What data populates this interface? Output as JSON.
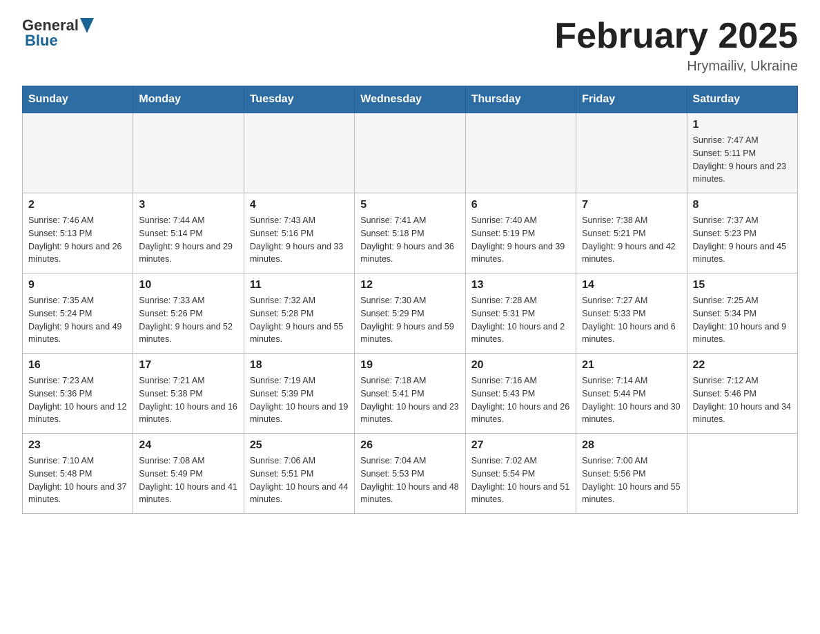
{
  "header": {
    "logo_general": "General",
    "logo_blue": "Blue",
    "month_title": "February 2025",
    "location": "Hrymailiv, Ukraine"
  },
  "days_of_week": [
    "Sunday",
    "Monday",
    "Tuesday",
    "Wednesday",
    "Thursday",
    "Friday",
    "Saturday"
  ],
  "weeks": [
    {
      "days": [
        {
          "number": "",
          "info": ""
        },
        {
          "number": "",
          "info": ""
        },
        {
          "number": "",
          "info": ""
        },
        {
          "number": "",
          "info": ""
        },
        {
          "number": "",
          "info": ""
        },
        {
          "number": "",
          "info": ""
        },
        {
          "number": "1",
          "info": "Sunrise: 7:47 AM\nSunset: 5:11 PM\nDaylight: 9 hours and 23 minutes."
        }
      ]
    },
    {
      "days": [
        {
          "number": "2",
          "info": "Sunrise: 7:46 AM\nSunset: 5:13 PM\nDaylight: 9 hours and 26 minutes."
        },
        {
          "number": "3",
          "info": "Sunrise: 7:44 AM\nSunset: 5:14 PM\nDaylight: 9 hours and 29 minutes."
        },
        {
          "number": "4",
          "info": "Sunrise: 7:43 AM\nSunset: 5:16 PM\nDaylight: 9 hours and 33 minutes."
        },
        {
          "number": "5",
          "info": "Sunrise: 7:41 AM\nSunset: 5:18 PM\nDaylight: 9 hours and 36 minutes."
        },
        {
          "number": "6",
          "info": "Sunrise: 7:40 AM\nSunset: 5:19 PM\nDaylight: 9 hours and 39 minutes."
        },
        {
          "number": "7",
          "info": "Sunrise: 7:38 AM\nSunset: 5:21 PM\nDaylight: 9 hours and 42 minutes."
        },
        {
          "number": "8",
          "info": "Sunrise: 7:37 AM\nSunset: 5:23 PM\nDaylight: 9 hours and 45 minutes."
        }
      ]
    },
    {
      "days": [
        {
          "number": "9",
          "info": "Sunrise: 7:35 AM\nSunset: 5:24 PM\nDaylight: 9 hours and 49 minutes."
        },
        {
          "number": "10",
          "info": "Sunrise: 7:33 AM\nSunset: 5:26 PM\nDaylight: 9 hours and 52 minutes."
        },
        {
          "number": "11",
          "info": "Sunrise: 7:32 AM\nSunset: 5:28 PM\nDaylight: 9 hours and 55 minutes."
        },
        {
          "number": "12",
          "info": "Sunrise: 7:30 AM\nSunset: 5:29 PM\nDaylight: 9 hours and 59 minutes."
        },
        {
          "number": "13",
          "info": "Sunrise: 7:28 AM\nSunset: 5:31 PM\nDaylight: 10 hours and 2 minutes."
        },
        {
          "number": "14",
          "info": "Sunrise: 7:27 AM\nSunset: 5:33 PM\nDaylight: 10 hours and 6 minutes."
        },
        {
          "number": "15",
          "info": "Sunrise: 7:25 AM\nSunset: 5:34 PM\nDaylight: 10 hours and 9 minutes."
        }
      ]
    },
    {
      "days": [
        {
          "number": "16",
          "info": "Sunrise: 7:23 AM\nSunset: 5:36 PM\nDaylight: 10 hours and 12 minutes."
        },
        {
          "number": "17",
          "info": "Sunrise: 7:21 AM\nSunset: 5:38 PM\nDaylight: 10 hours and 16 minutes."
        },
        {
          "number": "18",
          "info": "Sunrise: 7:19 AM\nSunset: 5:39 PM\nDaylight: 10 hours and 19 minutes."
        },
        {
          "number": "19",
          "info": "Sunrise: 7:18 AM\nSunset: 5:41 PM\nDaylight: 10 hours and 23 minutes."
        },
        {
          "number": "20",
          "info": "Sunrise: 7:16 AM\nSunset: 5:43 PM\nDaylight: 10 hours and 26 minutes."
        },
        {
          "number": "21",
          "info": "Sunrise: 7:14 AM\nSunset: 5:44 PM\nDaylight: 10 hours and 30 minutes."
        },
        {
          "number": "22",
          "info": "Sunrise: 7:12 AM\nSunset: 5:46 PM\nDaylight: 10 hours and 34 minutes."
        }
      ]
    },
    {
      "days": [
        {
          "number": "23",
          "info": "Sunrise: 7:10 AM\nSunset: 5:48 PM\nDaylight: 10 hours and 37 minutes."
        },
        {
          "number": "24",
          "info": "Sunrise: 7:08 AM\nSunset: 5:49 PM\nDaylight: 10 hours and 41 minutes."
        },
        {
          "number": "25",
          "info": "Sunrise: 7:06 AM\nSunset: 5:51 PM\nDaylight: 10 hours and 44 minutes."
        },
        {
          "number": "26",
          "info": "Sunrise: 7:04 AM\nSunset: 5:53 PM\nDaylight: 10 hours and 48 minutes."
        },
        {
          "number": "27",
          "info": "Sunrise: 7:02 AM\nSunset: 5:54 PM\nDaylight: 10 hours and 51 minutes."
        },
        {
          "number": "28",
          "info": "Sunrise: 7:00 AM\nSunset: 5:56 PM\nDaylight: 10 hours and 55 minutes."
        },
        {
          "number": "",
          "info": ""
        }
      ]
    }
  ]
}
